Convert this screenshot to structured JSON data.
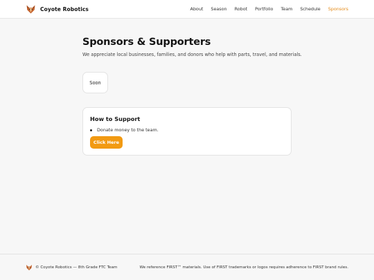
{
  "header": {
    "brand_name": "Coyote Robotics",
    "logo_icon": "coyote-logo-icon",
    "nav": [
      {
        "label": "About",
        "active": false
      },
      {
        "label": "Season",
        "active": false
      },
      {
        "label": "Robot",
        "active": false
      },
      {
        "label": "Portfolio",
        "active": false
      },
      {
        "label": "Team",
        "active": false
      },
      {
        "label": "Schedule",
        "active": false
      },
      {
        "label": "Sponsors",
        "active": true
      }
    ]
  },
  "main": {
    "title": "Sponsors & Supporters",
    "subtitle": "We appreciate local businesses, families, and donors who help with parts, travel, and materials.",
    "soon_card": {
      "label": "Soon"
    },
    "support": {
      "title": "How to Support",
      "items": [
        "Donate money to the team."
      ],
      "button_label": "Click Here"
    }
  },
  "footer": {
    "left_text": "© Coyote Robotics — 8th Grade FTC Team",
    "right_text": "We reference FIRST™ materials. Use of FIRST trademarks or logos requires adherence to FIRST brand rules."
  },
  "colors": {
    "accent": "#f29a12",
    "active_nav": "#e48a17",
    "page_bg": "#f7f7f7",
    "card_bg": "#ffffff"
  }
}
